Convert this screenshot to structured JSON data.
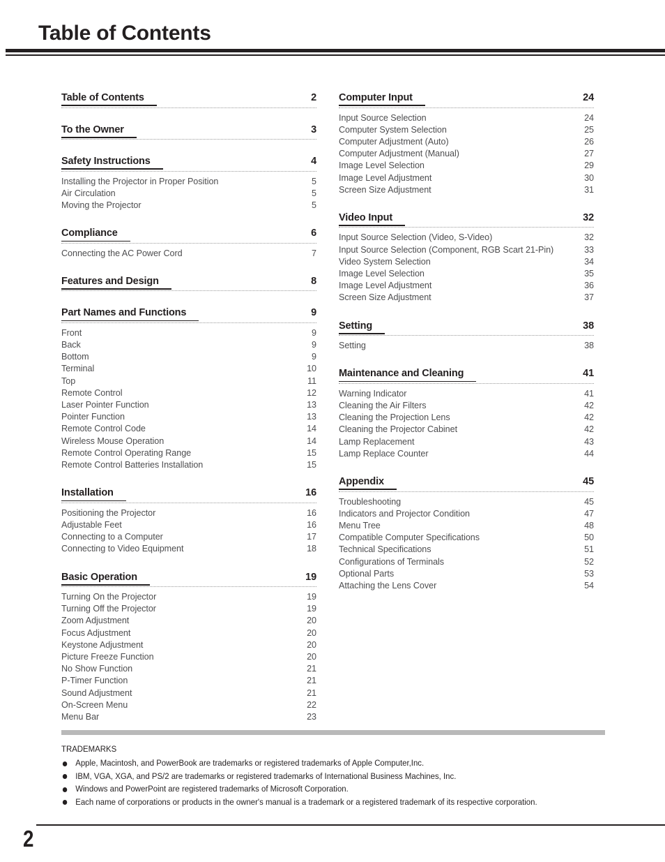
{
  "header": {
    "title": "Table of Contents"
  },
  "columns": {
    "left": [
      {
        "title": "Table of Contents",
        "page": "2",
        "entries": []
      },
      {
        "title": "To the Owner",
        "page": "3",
        "entries": []
      },
      {
        "title": "Safety Instructions",
        "page": "4",
        "entries": [
          {
            "title": "Installing the Projector in Proper Position",
            "page": "5"
          },
          {
            "title": "Air Circulation",
            "page": "5"
          },
          {
            "title": "Moving the Projector",
            "page": "5"
          }
        ]
      },
      {
        "title": "Compliance",
        "page": "6",
        "entries": [
          {
            "title": "Connecting the AC Power Cord",
            "page": "7"
          }
        ]
      },
      {
        "title": "Features and Design",
        "page": "8",
        "entries": []
      },
      {
        "title": "Part Names and Functions",
        "page": "9",
        "entries": [
          {
            "title": "Front",
            "page": "9"
          },
          {
            "title": "Back",
            "page": "9"
          },
          {
            "title": "Bottom",
            "page": "9"
          },
          {
            "title": "Terminal",
            "page": "10"
          },
          {
            "title": "Top",
            "page": "11"
          },
          {
            "title": "Remote Control",
            "page": "12"
          },
          {
            "title": "Laser Pointer Function",
            "page": "13"
          },
          {
            "title": "Pointer Function",
            "page": "13"
          },
          {
            "title": "Remote Control Code",
            "page": "14"
          },
          {
            "title": "Wireless Mouse Operation",
            "page": "14"
          },
          {
            "title": "Remote Control Operating Range",
            "page": "15"
          },
          {
            "title": "Remote Control Batteries Installation",
            "page": "15"
          }
        ]
      },
      {
        "title": "Installation",
        "page": "16",
        "entries": [
          {
            "title": "Positioning the Projector",
            "page": "16"
          },
          {
            "title": "Adjustable Feet",
            "page": "16"
          },
          {
            "title": "Connecting to a Computer",
            "page": "17"
          },
          {
            "title": "Connecting to Video Equipment",
            "page": "18"
          }
        ]
      },
      {
        "title": "Basic Operation",
        "page": "19",
        "entries": [
          {
            "title": "Turning On the Projector",
            "page": "19"
          },
          {
            "title": "Turning Off the Projector",
            "page": "19"
          },
          {
            "title": "Zoom Adjustment",
            "page": "20"
          },
          {
            "title": "Focus Adjustment",
            "page": "20"
          },
          {
            "title": "Keystone Adjustment",
            "page": "20"
          },
          {
            "title": "Picture Freeze Function",
            "page": "20"
          },
          {
            "title": "No Show Function",
            "page": "21"
          },
          {
            "title": "P-Timer Function",
            "page": "21"
          },
          {
            "title": "Sound Adjustment",
            "page": "21"
          },
          {
            "title": "On-Screen Menu",
            "page": "22"
          },
          {
            "title": "Menu Bar",
            "page": "23"
          }
        ]
      }
    ],
    "right": [
      {
        "title": "Computer Input",
        "page": "24",
        "entries": [
          {
            "title": "Input Source Selection",
            "page": "24"
          },
          {
            "title": "Computer System Selection",
            "page": "25"
          },
          {
            "title": "Computer Adjustment (Auto)",
            "page": "26"
          },
          {
            "title": "Computer Adjustment (Manual)",
            "page": "27"
          },
          {
            "title": "Image Level Selection",
            "page": "29"
          },
          {
            "title": "Image Level Adjustment",
            "page": "30"
          },
          {
            "title": "Screen Size Adjustment",
            "page": "31"
          }
        ]
      },
      {
        "title": "Video Input",
        "page": "32",
        "entries": [
          {
            "title": "Input Source Selection (Video, S-Video)",
            "page": "32"
          },
          {
            "title": "Input Source Selection (Component, RGB Scart 21-Pin)",
            "page": "33"
          },
          {
            "title": "Video System Selection",
            "page": "34"
          },
          {
            "title": "Image Level Selection",
            "page": "35"
          },
          {
            "title": "Image Level Adjustment",
            "page": "36"
          },
          {
            "title": "Screen Size Adjustment",
            "page": "37"
          }
        ]
      },
      {
        "title": "Setting",
        "page": "38",
        "entries": [
          {
            "title": "Setting",
            "page": "38"
          }
        ]
      },
      {
        "title": "Maintenance and Cleaning",
        "page": "41",
        "entries": [
          {
            "title": "Warning Indicator",
            "page": "41"
          },
          {
            "title": "Cleaning the Air Filters",
            "page": "42"
          },
          {
            "title": "Cleaning the Projection Lens",
            "page": "42"
          },
          {
            "title": "Cleaning the Projector Cabinet",
            "page": "42"
          },
          {
            "title": "Lamp Replacement",
            "page": "43"
          },
          {
            "title": "Lamp Replace Counter",
            "page": "44"
          }
        ]
      },
      {
        "title": "Appendix",
        "page": "45",
        "entries": [
          {
            "title": "Troubleshooting",
            "page": "45"
          },
          {
            "title": "Indicators and Projector Condition",
            "page": "47"
          },
          {
            "title": "Menu Tree",
            "page": "48"
          },
          {
            "title": "Compatible Computer Specifications",
            "page": "50"
          },
          {
            "title": "Technical Specifications",
            "page": "51"
          },
          {
            "title": "Configurations of Terminals",
            "page": "52"
          },
          {
            "title": "Optional Parts",
            "page": "53"
          },
          {
            "title": "Attaching the Lens Cover",
            "page": "54"
          }
        ]
      }
    ]
  },
  "trademarks": {
    "heading": "TRADEMARKS",
    "items": [
      "Apple, Macintosh, and PowerBook are trademarks or registered trademarks of Apple Computer,Inc.",
      "IBM, VGA, XGA, and PS/2 are trademarks or registered trademarks of International Business Machines, Inc.",
      "Windows and PowerPoint are registered trademarks of Microsoft Corporation.",
      "Each name of corporations or products in the owner's manual is a trademark or a registered trademark of its respective corporation."
    ]
  },
  "footer": {
    "page_number": "2"
  }
}
